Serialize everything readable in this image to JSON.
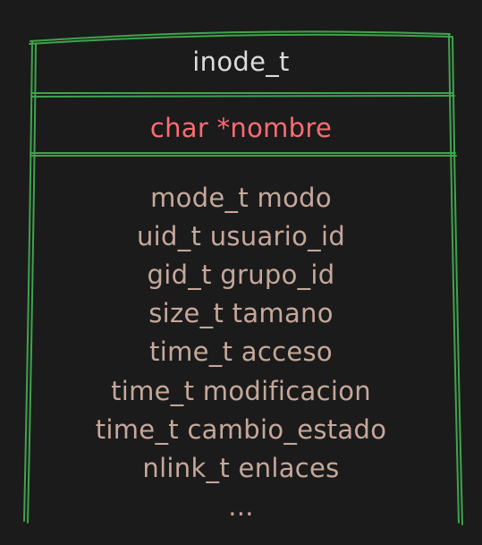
{
  "entity": {
    "title": "inode_t",
    "key_field": "char *nombre",
    "fields": [
      "mode_t modo",
      "uid_t usuario_id",
      "gid_t grupo_id",
      "size_t tamano",
      "time_t acceso",
      "time_t modificacion",
      "time_t cambio_estado",
      "nlink_t enlaces",
      "..."
    ]
  },
  "colors": {
    "background": "#1b1b1b",
    "border": "#3fa34d",
    "title": "#dcdcdc",
    "key_field": "#ff6b73",
    "field": "#c5a89b"
  }
}
